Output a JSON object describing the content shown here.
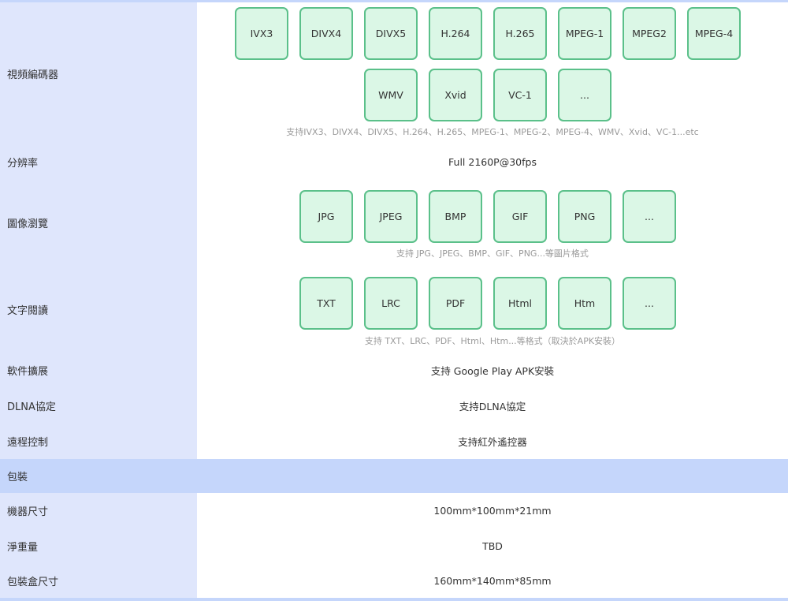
{
  "video": {
    "label": "視頻編碼器",
    "row1": [
      "IVX3",
      "DIVX4",
      "DIVX5",
      "H.264",
      "H.265",
      "MPEG-1",
      "MPEG2",
      "MPEG-4"
    ],
    "row2": [
      "WMV",
      "Xvid",
      "VC-1",
      "..."
    ],
    "note": "支持IVX3、DIVX4、DIVX5、H.264、H.265、MPEG-1、MPEG-2、MPEG-4、WMV、Xvid、VC-1...etc"
  },
  "resolution": {
    "label": "分辨率",
    "value": "Full 2160P@30fps"
  },
  "image": {
    "label": "圖像瀏覽",
    "tiles": [
      "JPG",
      "JPEG",
      "BMP",
      "GIF",
      "PNG",
      "..."
    ],
    "note": "支持 JPG、JPEG、BMP、GIF、PNG...等圖片格式"
  },
  "text": {
    "label": "文字閱讀",
    "tiles": [
      "TXT",
      "LRC",
      "PDF",
      "Html",
      "Htm",
      "..."
    ],
    "note": "支持 TXT、LRC、PDF、Html、Htm...等格式（取決於APK安裝）"
  },
  "software": {
    "label": "軟件擴展",
    "value": "支持 Google Play APK安裝"
  },
  "dlna": {
    "label": "DLNA協定",
    "value": "支持DLNA協定"
  },
  "remote": {
    "label": "遠程控制",
    "value": "支持紅外遙控器"
  },
  "packaging": {
    "label": "包裝"
  },
  "size": {
    "label": "機器尺寸",
    "value": "100mm*100mm*21mm"
  },
  "weight": {
    "label": "淨重量",
    "value": "TBD"
  },
  "box": {
    "label": "包裝盒尺寸",
    "value": "160mm*140mm*85mm"
  }
}
